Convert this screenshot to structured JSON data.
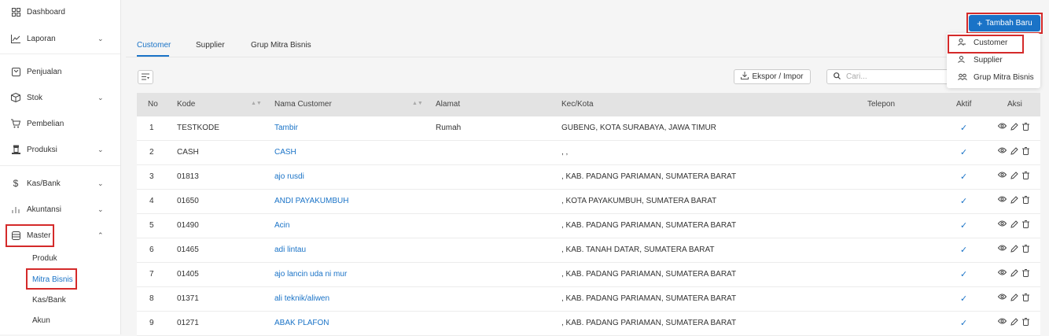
{
  "sidebar": {
    "items": [
      {
        "icon": "dashboard-icon",
        "label": "Dashboard"
      },
      {
        "icon": "chart-line-icon",
        "label": "Laporan"
      },
      {
        "icon": "receipt-icon",
        "label": "Penjualan"
      },
      {
        "icon": "box-icon",
        "label": "Stok"
      },
      {
        "icon": "cart-icon",
        "label": "Pembelian"
      },
      {
        "icon": "factory-icon",
        "label": "Produksi"
      },
      {
        "icon": "dollar-icon",
        "label": "Kas/Bank"
      },
      {
        "icon": "bar-chart-icon",
        "label": "Akuntansi"
      },
      {
        "icon": "database-icon",
        "label": "Master"
      }
    ],
    "master_sub": [
      "Produk",
      "Mitra Bisnis",
      "Kas/Bank",
      "Akun"
    ]
  },
  "toolbar": {
    "add_new_label": "Tambah Baru",
    "export_label": "Ekspor / Impor",
    "search_placeholder": "Cari..."
  },
  "tabs": [
    "Customer",
    "Supplier",
    "Grup Mitra Bisnis"
  ],
  "dropdown": [
    {
      "icon": "user-icon",
      "label": "Customer"
    },
    {
      "icon": "user-icon",
      "label": "Supplier"
    },
    {
      "icon": "users-icon",
      "label": "Grup Mitra Bisnis"
    }
  ],
  "table": {
    "headers": [
      "No",
      "Kode",
      "Nama Customer",
      "Alamat",
      "Kec/Kota",
      "Telepon",
      "Aktif",
      "Aksi"
    ],
    "rows": [
      {
        "no": "1",
        "kode": "TESTKODE",
        "nama": "Tambir",
        "alamat": "Rumah",
        "kota": "GUBENG, KOTA SURABAYA, JAWA TIMUR"
      },
      {
        "no": "2",
        "kode": "CASH",
        "nama": "CASH",
        "alamat": "",
        "kota": ", ,"
      },
      {
        "no": "3",
        "kode": "01813",
        "nama": "ajo rusdi",
        "alamat": "",
        "kota": ", KAB. PADANG PARIAMAN, SUMATERA BARAT"
      },
      {
        "no": "4",
        "kode": "01650",
        "nama": "ANDI PAYAKUMBUH",
        "alamat": "",
        "kota": ", KOTA PAYAKUMBUH, SUMATERA BARAT"
      },
      {
        "no": "5",
        "kode": "01490",
        "nama": "Acin",
        "alamat": "",
        "kota": ", KAB. PADANG PARIAMAN, SUMATERA BARAT"
      },
      {
        "no": "6",
        "kode": "01465",
        "nama": "adi lintau",
        "alamat": "",
        "kota": ", KAB. TANAH DATAR, SUMATERA BARAT"
      },
      {
        "no": "7",
        "kode": "01405",
        "nama": "ajo lancin uda ni mur",
        "alamat": "",
        "kota": ", KAB. PADANG PARIAMAN, SUMATERA BARAT"
      },
      {
        "no": "8",
        "kode": "01371",
        "nama": "ali teknik/aliwen",
        "alamat": "",
        "kota": ", KAB. PADANG PARIAMAN, SUMATERA BARAT"
      },
      {
        "no": "9",
        "kode": "01271",
        "nama": "ABAK PLAFON",
        "alamat": "",
        "kota": ", KAB. PADANG PARIAMAN, SUMATERA BARAT"
      }
    ]
  },
  "colors": {
    "accent": "#1a73c7",
    "highlight": "#d42a2a"
  }
}
